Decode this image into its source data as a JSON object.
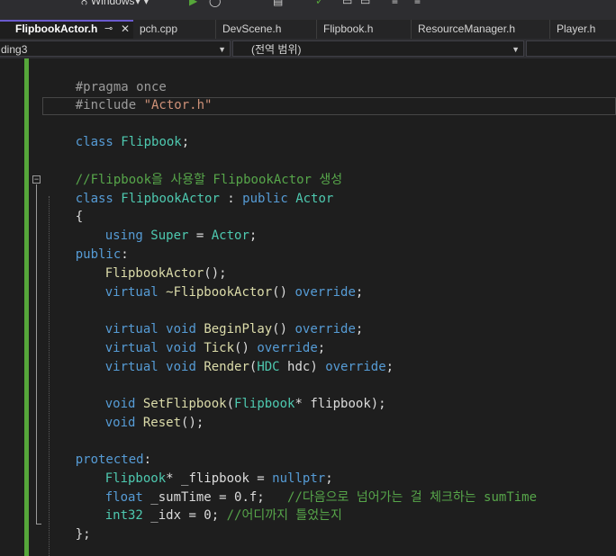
{
  "toolbar": {
    "left_text": "ਨ Windows",
    "mid_text": "▾ ▾"
  },
  "tabs": [
    {
      "label": "FlipbookActor.h",
      "active": true
    },
    {
      "label": "pch.cpp"
    },
    {
      "label": "DevScene.h"
    },
    {
      "label": "Flipbook.h"
    },
    {
      "label": "ResourceManager.h"
    },
    {
      "label": "Player.h"
    }
  ],
  "tab_pin_glyph": "⊸",
  "tab_close_glyph": "✕",
  "navbar": {
    "project": "ding3",
    "scope": "(전역 범위)"
  },
  "code": {
    "line1": {
      "a": "#pragma once"
    },
    "line2": {
      "a": "#include ",
      "b": "\"Actor.h\""
    },
    "line4": {
      "a": "class ",
      "b": "Flipbook",
      "c": ";"
    },
    "line6": {
      "a": "//Flipbook을 사용할 FlipbookActor 생성"
    },
    "line7": {
      "a": "class ",
      "b": "FlipbookActor",
      "c": " : ",
      "d": "public ",
      "e": "Actor"
    },
    "line8": {
      "a": "{"
    },
    "line9": {
      "a": "using ",
      "b": "Super",
      "c": " = ",
      "d": "Actor",
      "e": ";"
    },
    "line10": {
      "a": "public",
      "b": ":"
    },
    "line11": {
      "a": "FlipbookActor",
      "b": "();"
    },
    "line12": {
      "a": "virtual ",
      "b": "~FlipbookActor",
      "c": "() ",
      "d": "override",
      "e": ";"
    },
    "line14": {
      "a": "virtual ",
      "b": "void ",
      "c": "BeginPlay",
      "d": "() ",
      "e": "override",
      "f": ";"
    },
    "line15": {
      "a": "virtual ",
      "b": "void ",
      "c": "Tick",
      "d": "() ",
      "e": "override",
      "f": ";"
    },
    "line16": {
      "a": "virtual ",
      "b": "void ",
      "c": "Render",
      "d": "(",
      "e": "HDC",
      "f": " hdc) ",
      "g": "override",
      "h": ";"
    },
    "line18": {
      "a": "void ",
      "b": "SetFlipbook",
      "c": "(",
      "d": "Flipbook",
      "e": "* flipbook);"
    },
    "line19": {
      "a": "void ",
      "b": "Reset",
      "c": "();"
    },
    "line21": {
      "a": "protected",
      "b": ":"
    },
    "line22": {
      "a": "Flipbook",
      "b": "* _flipbook = ",
      "c": "nullptr",
      "d": ";"
    },
    "line23": {
      "a": "float",
      "b": " _sumTime = 0.f;   ",
      "c": "//다음으로 넘어가는 걸 체크하는 sumTime"
    },
    "line24": {
      "a": "int32",
      "b": " _idx = 0; ",
      "c": "//어디까지 틀었는지"
    },
    "line25": {
      "a": "};"
    }
  },
  "colors": {
    "keyword": "#569cd6",
    "type": "#4ec9b0",
    "function": "#dcdcaa",
    "string": "#ce9178",
    "comment": "#57a64a",
    "preprocessor": "#9b9b9b",
    "change_bar": "#56a63a",
    "active_tab_accent": "#6a5acd"
  }
}
